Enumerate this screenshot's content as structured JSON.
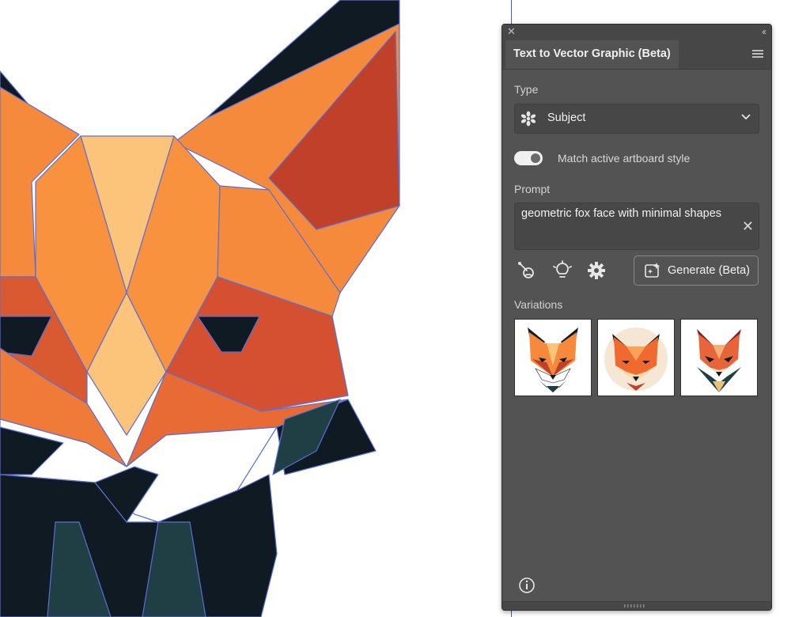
{
  "canvas": {
    "artwork": "geometric-fox-artwork"
  },
  "panel": {
    "close_glyph": "✕",
    "collapse_glyph": "‹‹",
    "tab_title": "Text to Vector Graphic (Beta)",
    "type": {
      "label": "Type",
      "value": "Subject",
      "icon": "flower-icon"
    },
    "match_style": {
      "label": "Match active artboard style",
      "enabled": true
    },
    "prompt": {
      "label": "Prompt",
      "value": "geometric fox face with minimal shapes",
      "clear_glyph": "✕"
    },
    "tools": {
      "icons": [
        "eyedropper-icon",
        "lightbulb-icon",
        "gear-icon"
      ]
    },
    "generate": {
      "label": "Generate (Beta)",
      "icon": "generate-sparkle-icon"
    },
    "variations": {
      "label": "Variations",
      "count": 3
    }
  },
  "colors": {
    "panel_bg": "#535353",
    "panel_field_bg": "#474747",
    "fox_orange": "#f58a3c",
    "fox_light": "#fbc47a",
    "fox_red": "#c0402a",
    "fox_dark": "#0f1a22",
    "fox_teal": "#1f3f44",
    "outline_blue": "#5a6fd6"
  }
}
